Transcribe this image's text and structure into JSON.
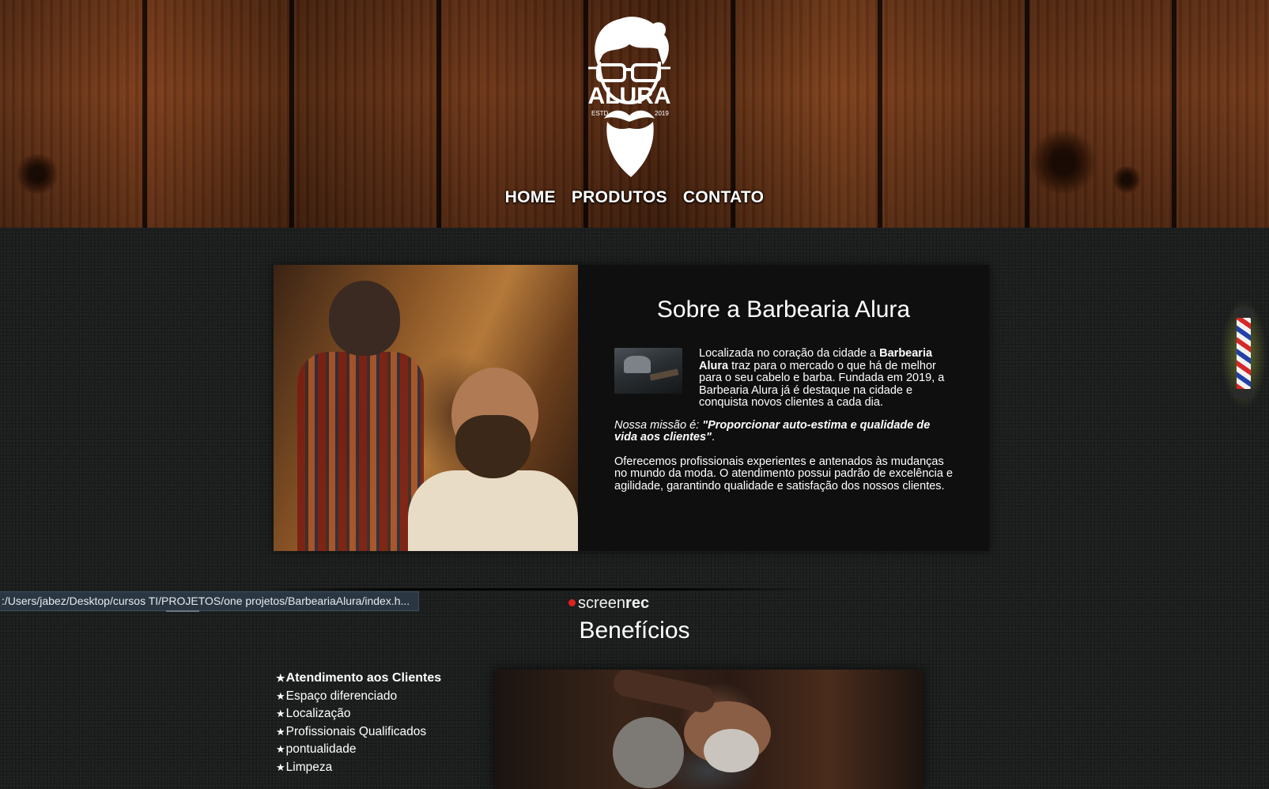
{
  "header": {
    "logo": {
      "brand": "ALURA",
      "estd_label": "ESTD",
      "year": "2019"
    },
    "nav": [
      {
        "label": "HOME"
      },
      {
        "label": "PRODUTOS"
      },
      {
        "label": "CONTATO"
      }
    ]
  },
  "about": {
    "title": "Sobre a Barbearia Alura",
    "intro": {
      "text_before": "Localizada no coração da cidade a ",
      "bold": "Barbearia Alura",
      "text_after": " traz para o mercado o que há de melhor para o seu cabelo e barba. Fundada em 2019, a Barbearia Alura já é destaque na cidade e conquista novos clientes a cada dia."
    },
    "mission": {
      "label": "Nossa missão é: ",
      "quote": "\"Proporcionar auto-estima e qualidade de vida aos clientes\"",
      "end": "."
    },
    "services": "Oferecemos profissionais experientes e antenados às mudanças no mundo da moda. O atendimento possui padrão de excelência e agilidade, garantindo qualidade e satisfação dos nossos clientes."
  },
  "status_bar": {
    "url": ":/Users/jabez/Desktop/cursos TI/PROJETOS/one projetos/BarbeariaAlura/index.h..."
  },
  "recorder": {
    "text_regular": "screen",
    "text_bold": "rec",
    "dot_color": "#e02020"
  },
  "benefits": {
    "title": "Benefícios",
    "star": "★",
    "items": [
      "Atendimento aos Clientes",
      "Espaço diferenciado",
      "Localização",
      "Profissionais Qualificados",
      "pontualidade",
      "Limpeza"
    ]
  },
  "decor": {
    "barber_pole": "barber-pole-icon"
  }
}
